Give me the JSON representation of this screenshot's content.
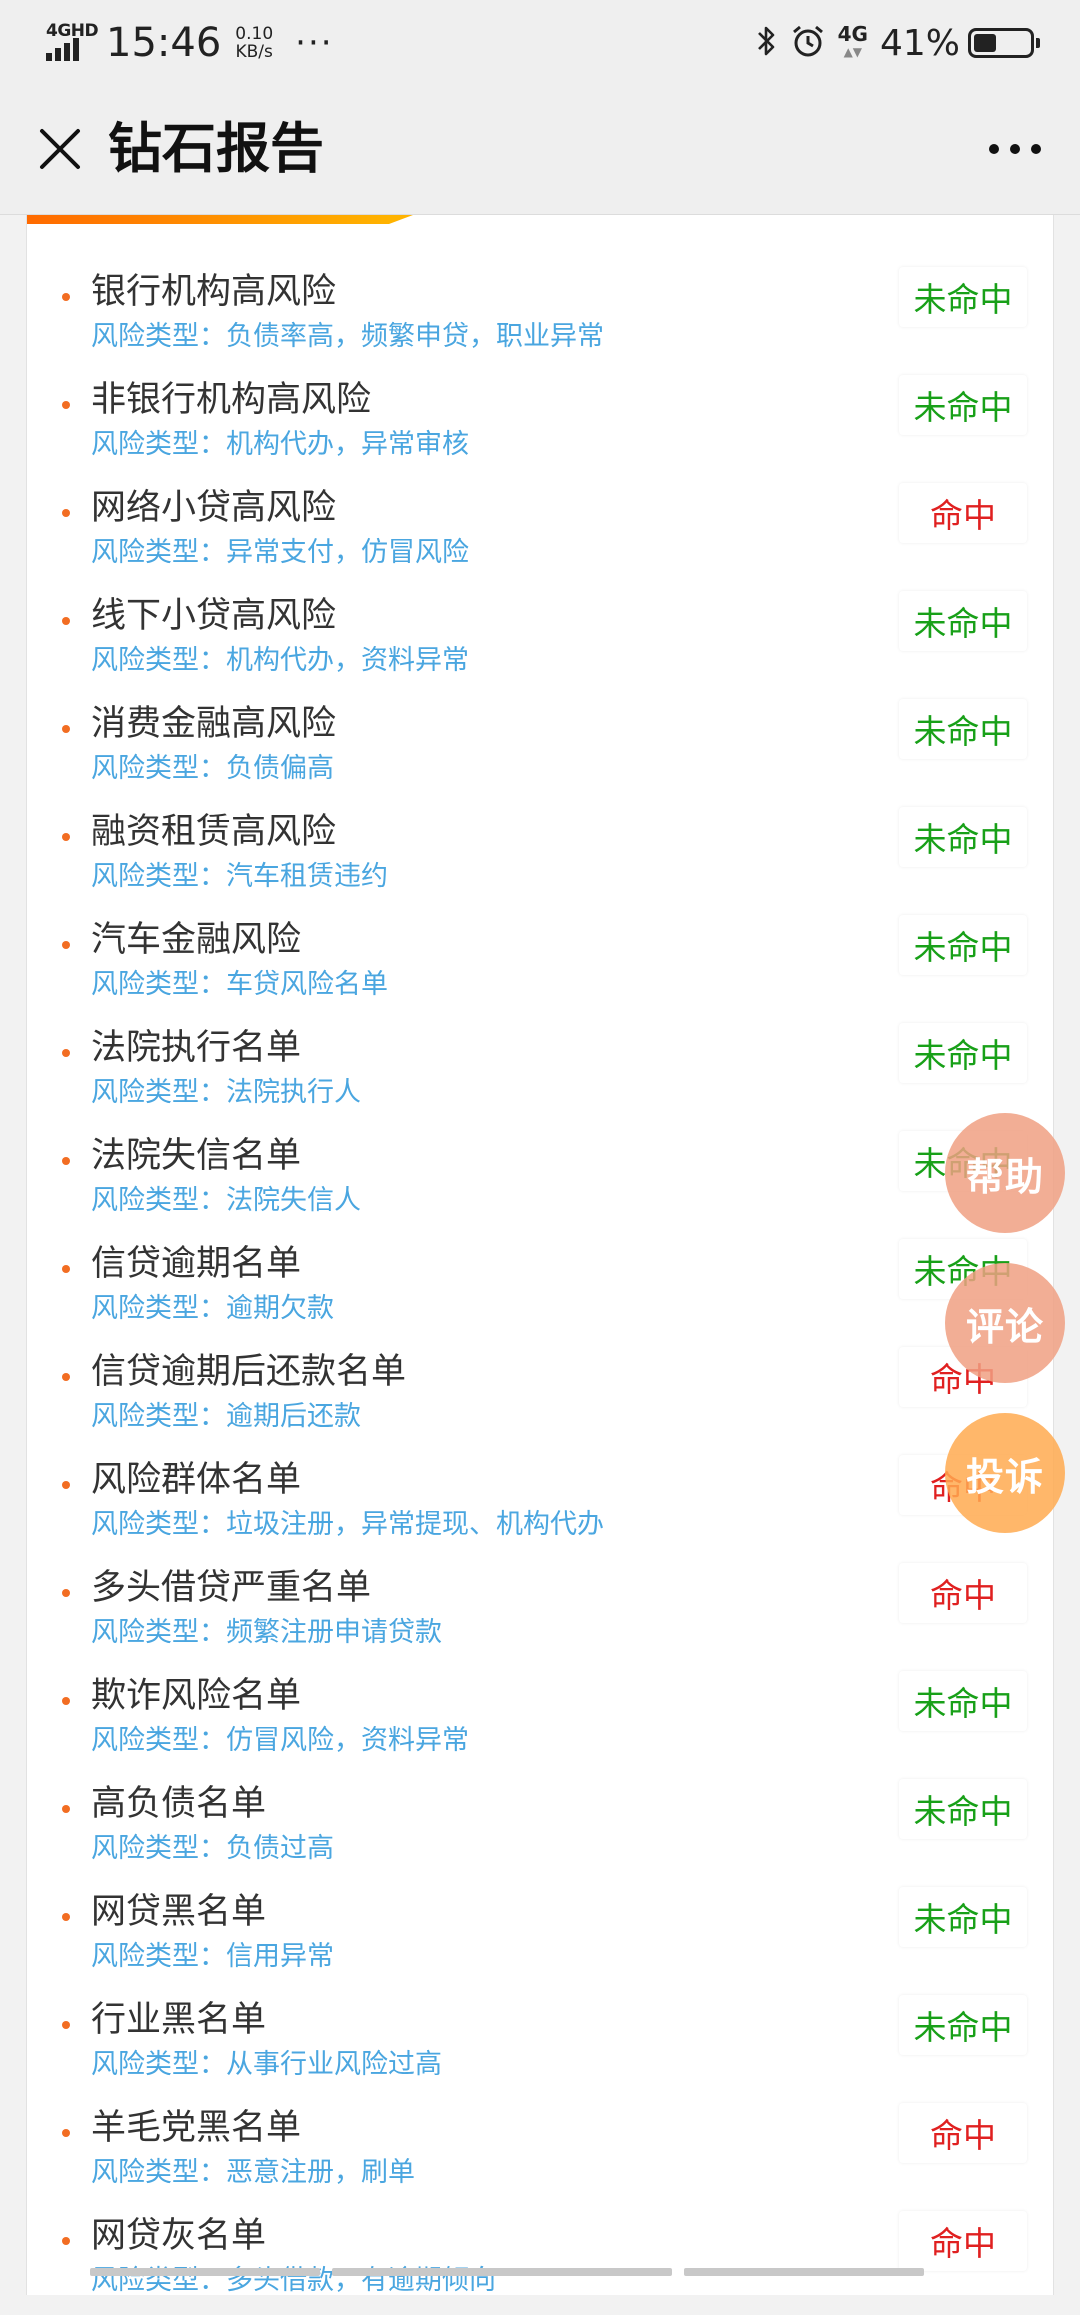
{
  "status_bar": {
    "network": "4GHD",
    "time": "15:46",
    "speed_value": "0.10",
    "speed_unit": "KB/s",
    "more": "···",
    "lte": "4G",
    "battery_percent": "41%",
    "battery_level": 0.41
  },
  "header": {
    "title": "钻石报告"
  },
  "type_prefix": "风险类型：",
  "items": [
    {
      "title": "银行机构高风险",
      "type": "负债率高，频繁申贷，职业异常",
      "status": "未命中"
    },
    {
      "title": "非银行机构高风险",
      "type": "机构代办，异常审核",
      "status": "未命中"
    },
    {
      "title": "网络小贷高风险",
      "type": "异常支付，仿冒风险",
      "status": "命中"
    },
    {
      "title": "线下小贷高风险",
      "type": "机构代办，资料异常",
      "status": "未命中"
    },
    {
      "title": "消费金融高风险",
      "type": "负债偏高",
      "status": "未命中"
    },
    {
      "title": "融资租赁高风险",
      "type": "汽车租赁违约",
      "status": "未命中"
    },
    {
      "title": "汽车金融风险",
      "type": "车贷风险名单",
      "status": "未命中"
    },
    {
      "title": "法院执行名单",
      "type": "法院执行人",
      "status": "未命中"
    },
    {
      "title": "法院失信名单",
      "type": "法院失信人",
      "status": "未命中"
    },
    {
      "title": "信贷逾期名单",
      "type": "逾期欠款",
      "status": "未命中"
    },
    {
      "title": "信贷逾期后还款名单",
      "type": "逾期后还款",
      "status": "命中"
    },
    {
      "title": "风险群体名单",
      "type": "垃圾注册，异常提现、机构代办",
      "status": "命中"
    },
    {
      "title": "多头借贷严重名单",
      "type": "频繁注册申请贷款",
      "status": "命中"
    },
    {
      "title": "欺诈风险名单",
      "type": "仿冒风险，资料异常",
      "status": "未命中"
    },
    {
      "title": "高负债名单",
      "type": "负债过高",
      "status": "未命中"
    },
    {
      "title": "网贷黑名单",
      "type": "信用异常",
      "status": "未命中"
    },
    {
      "title": "行业黑名单",
      "type": "从事行业风险过高",
      "status": "未命中"
    },
    {
      "title": "羊毛党黑名单",
      "type": "恶意注册，刷单",
      "status": "命中"
    },
    {
      "title": "网贷灰名单",
      "type": "多头借款，有逾期倾向",
      "status": "命中"
    }
  ],
  "floating": {
    "help": "帮助",
    "comment": "评论",
    "complain": "投诉"
  },
  "colors": {
    "hit": "#e02020",
    "miss": "#18a018",
    "type_text": "#4aa6e0",
    "bullet": "#f26d22",
    "accent_start": "#ff6a00",
    "accent_end": "#ffb300"
  }
}
